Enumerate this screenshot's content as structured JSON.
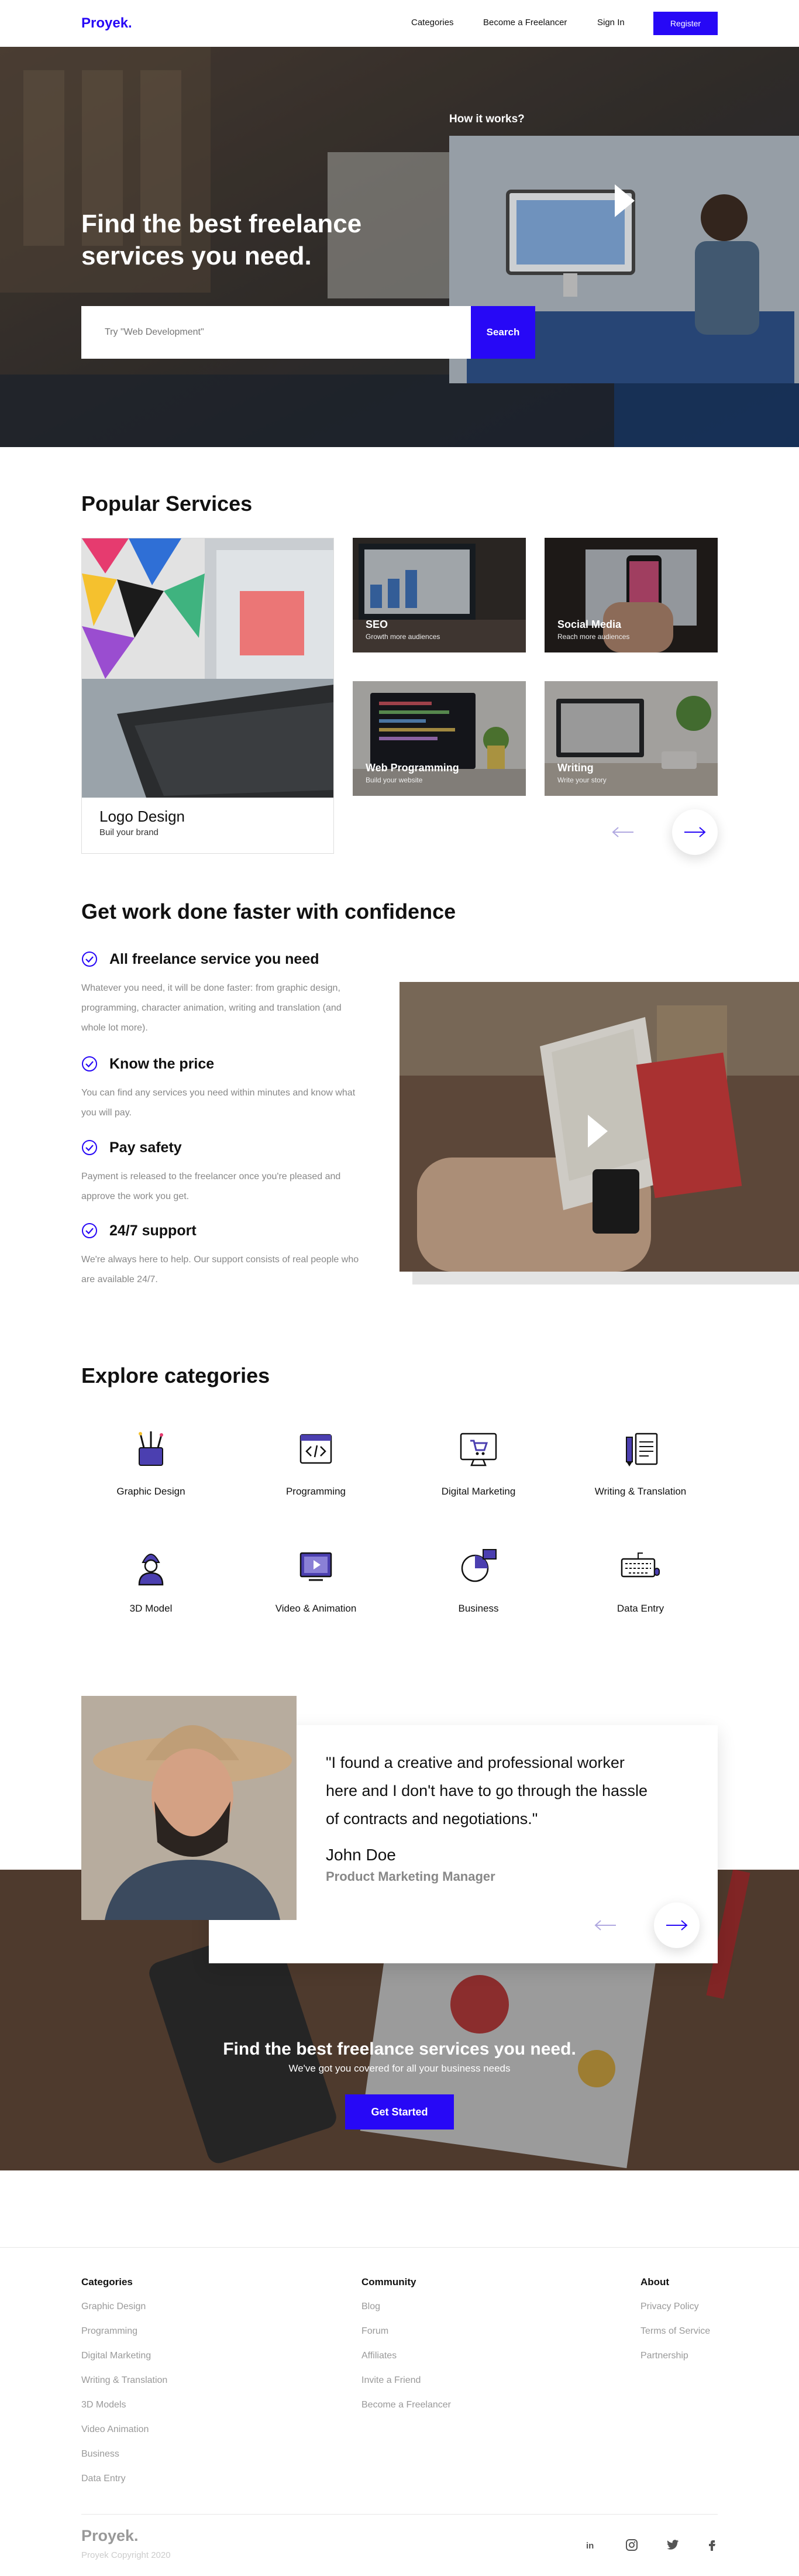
{
  "nav": {
    "logo": "Proyek.",
    "links": [
      "Categories",
      "Become a Freelancer",
      "Sign In"
    ],
    "register": "Register"
  },
  "hero": {
    "title": "Find the best freelance services you need.",
    "search_placeholder": "Try \"Web Development\"",
    "search_button": "Search",
    "video_label": "How it works?"
  },
  "popular": {
    "title": "Popular Services",
    "featured": {
      "title": "Logo Design",
      "subtitle": "Buil your brand"
    },
    "services": [
      {
        "title": "SEO",
        "subtitle": "Growth more audiences"
      },
      {
        "title": "Social Media",
        "subtitle": "Reach more audiences"
      },
      {
        "title": "Web Programming",
        "subtitle": "Build your website"
      },
      {
        "title": "Writing",
        "subtitle": "Write your story"
      }
    ]
  },
  "confidence": {
    "title": "Get work done faster with confidence",
    "features": [
      {
        "title": "All freelance service you need",
        "text": "Whatever you need, it will be done faster: from graphic design, programming, character animation, writing and translation (and whole lot more)."
      },
      {
        "title": "Know the price",
        "text": "You can find any services you need within minutes and know what you will pay."
      },
      {
        "title": "Pay safety",
        "text": "Payment is released to the freelancer once you're pleased and approve the work you get."
      },
      {
        "title": "24/7 support",
        "text": "We're always here to help. Our support consists of real people who are available 24/7."
      }
    ]
  },
  "categories": {
    "title": "Explore categories",
    "items": [
      {
        "label": "Graphic Design",
        "icon": "graphic-design-icon"
      },
      {
        "label": "Programming",
        "icon": "programming-icon"
      },
      {
        "label": "Digital Marketing",
        "icon": "digital-marketing-icon"
      },
      {
        "label": "Writing & Translation",
        "icon": "writing-icon"
      },
      {
        "label": "3D Model",
        "icon": "3d-model-icon"
      },
      {
        "label": "Video & Animation",
        "icon": "video-animation-icon"
      },
      {
        "label": "Business",
        "icon": "business-icon"
      },
      {
        "label": "Data Entry",
        "icon": "data-entry-icon"
      }
    ]
  },
  "testimonial": {
    "quote": "\"I found a creative and professional worker here and I don't have to go through the hassle of contracts and negotiations.\"",
    "name": "John Doe",
    "role": "Product Marketing Manager"
  },
  "cta": {
    "title": "Find the best freelance services you need.",
    "subtitle": "We've got you covered for all your business needs",
    "button": "Get Started"
  },
  "footer": {
    "columns": [
      {
        "heading": "Categories",
        "items": [
          "Graphic Design",
          "Programming",
          "Digital Marketing",
          "Writing & Translation",
          "3D Models",
          "Video Animation",
          "Business",
          "Data Entry"
        ]
      },
      {
        "heading": "Community",
        "items": [
          "Blog",
          "Forum",
          "Affiliates",
          "Invite a Friend",
          "Become a Freelancer"
        ]
      },
      {
        "heading": "About",
        "items": [
          "Privacy Policy",
          "Terms of Service",
          "Partnership"
        ]
      }
    ],
    "logo": "Proyek.",
    "copyright": "Proyek Copyright 2020",
    "social": [
      "linkedin-icon",
      "instagram-icon",
      "twitter-icon",
      "facebook-icon"
    ]
  },
  "colors": {
    "accent": "#2708f6",
    "muted": "#888888",
    "divider": "#e6e6e6"
  }
}
